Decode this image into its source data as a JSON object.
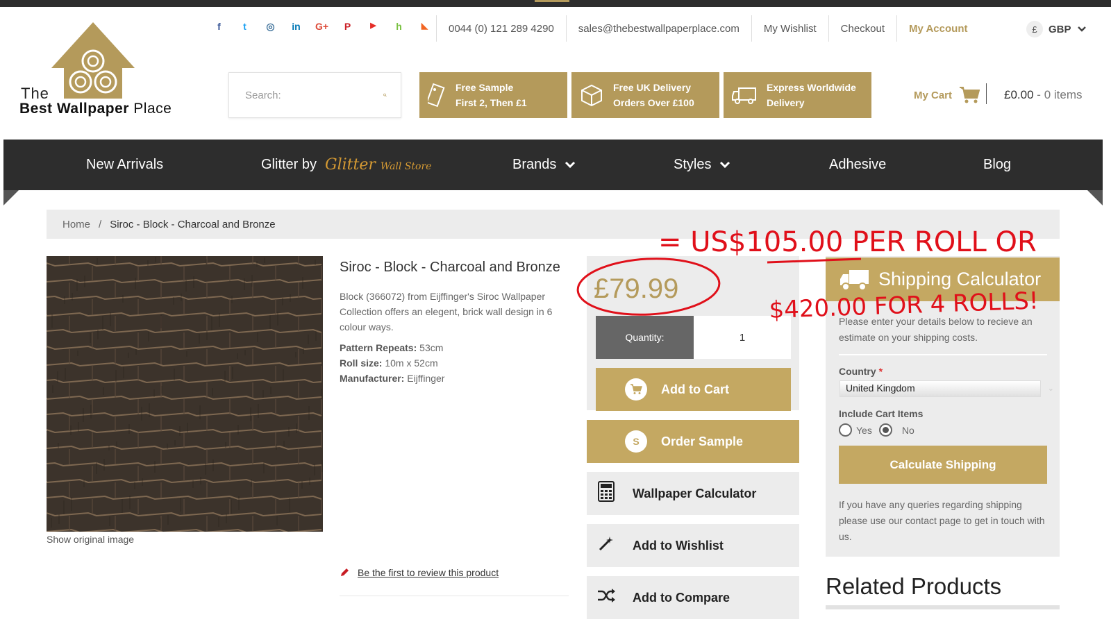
{
  "brand": {
    "logo_the": "The",
    "logo_bold": "Best Wallpaper",
    "logo_rest": "Place"
  },
  "social": [
    {
      "icon": "facebook-icon",
      "glyph": "f",
      "color": "#3b5998"
    },
    {
      "icon": "twitter-icon",
      "glyph": "t",
      "color": "#1da1f2"
    },
    {
      "icon": "instagram-icon",
      "glyph": "◎",
      "color": "#3f729b"
    },
    {
      "icon": "linkedin-icon",
      "glyph": "in",
      "color": "#0077b5"
    },
    {
      "icon": "google-plus-icon",
      "glyph": "G+",
      "color": "#dd4b39"
    },
    {
      "icon": "pinterest-icon",
      "glyph": "P",
      "color": "#cb2027"
    },
    {
      "icon": "youtube-icon",
      "glyph": "▶",
      "color": "#e52d27"
    },
    {
      "icon": "houzz-icon",
      "glyph": "h",
      "color": "#7ac142"
    },
    {
      "icon": "rss-icon",
      "glyph": "◣",
      "color": "#f26522"
    }
  ],
  "toplinks": {
    "phone": "0044 (0) 121 289 4290",
    "email": "sales@thebestwallpaperplace.com",
    "wishlist": "My Wishlist",
    "checkout": "Checkout",
    "account": "My Account",
    "currency_symbol": "£",
    "currency": "GBP"
  },
  "search": {
    "placeholder": "Search:"
  },
  "promos": [
    {
      "line1": "Free Sample",
      "line2": "First 2, Then £1",
      "icon": "sample-tag-icon"
    },
    {
      "line1": "Free UK Delivery",
      "line2": "Orders Over £100",
      "icon": "box-icon"
    },
    {
      "line1": "Express Worldwide",
      "line2": "Delivery",
      "icon": "truck-icon"
    }
  ],
  "cart": {
    "label": "My Cart",
    "total": "£0.00",
    "dash": "-",
    "items": "0 items"
  },
  "nav": {
    "new_arrivals": "New Arrivals",
    "glitter_prefix": "Glitter by",
    "glitter_logo": "Glitter",
    "glitter_logo_small": "Wall Store",
    "brands": "Brands",
    "styles": "Styles",
    "adhesive": "Adhesive",
    "blog": "Blog"
  },
  "breadcrumb": {
    "home": "Home",
    "sep": "/",
    "current": "Siroc - Block - Charcoal and Bronze"
  },
  "product": {
    "title": "Siroc - Block - Charcoal and Bronze",
    "description": "Block (366072) from Eijffinger's Siroc Wallpaper Collection offers an elegent, brick wall design in 6 colour ways.",
    "specs": [
      {
        "label": "Pattern Repeats:",
        "value": "53cm"
      },
      {
        "label": "Roll size:",
        "value": "10m x 52cm"
      },
      {
        "label": "Manufacturer:",
        "value": "Eijffinger"
      }
    ],
    "show_original": "Show original image",
    "review_link": "Be the first to review this product",
    "price": "£79.99",
    "quantity_label": "Quantity:",
    "quantity_value": "1"
  },
  "actions": {
    "add_to_cart": "Add to Cart",
    "order_sample": "Order Sample",
    "sample_badge": "S",
    "wallpaper_calculator": "Wallpaper Calculator",
    "add_to_wishlist": "Add to Wishlist",
    "add_to_compare": "Add to Compare"
  },
  "shipping": {
    "title": "Shipping Calculator",
    "intro": "Please enter your details below to recieve an estimate on your shipping costs.",
    "country_label": "Country",
    "required_mark": "*",
    "country_value": "United Kingdom",
    "include_label": "Include Cart Items",
    "yes": "Yes",
    "no": "No",
    "include_cart_items": "No",
    "button": "Calculate Shipping",
    "footer": "If you have any queries regarding shipping please use our contact page to get in touch with us."
  },
  "related_title": "Related Products",
  "annotation": {
    "color": "#e0101a",
    "line1": "= US$105.00 PER ROLL OR",
    "line2": "$420.00 FOR 4 ROLLS!"
  },
  "colors": {
    "accent": "#b49a5b",
    "nav_bg": "#2d2d2d",
    "panel": "#ececec"
  }
}
